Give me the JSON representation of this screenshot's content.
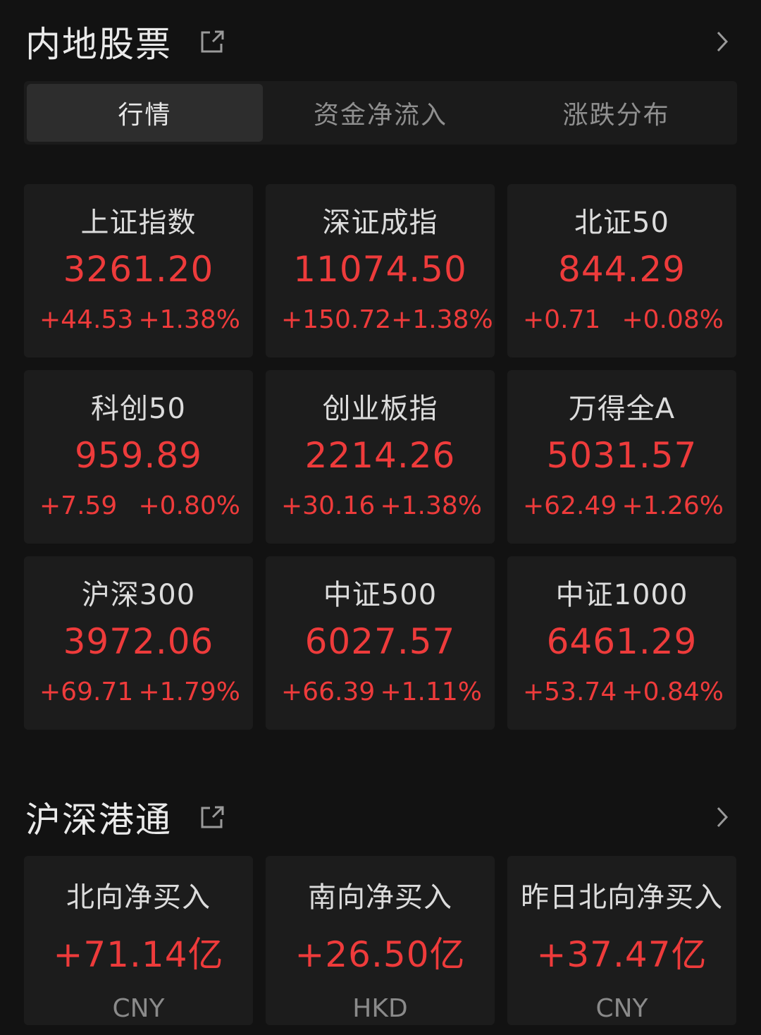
{
  "section1": {
    "title": "内地股票",
    "tabs": [
      "行情",
      "资金净流入",
      "涨跌分布"
    ],
    "cards": [
      {
        "name": "上证指数",
        "value": "3261.20",
        "change": "+44.53",
        "pct": "+1.38%"
      },
      {
        "name": "深证成指",
        "value": "11074.50",
        "change": "+150.72",
        "pct": "+1.38%"
      },
      {
        "name": "北证50",
        "value": "844.29",
        "change": "+0.71",
        "pct": "+0.08%"
      },
      {
        "name": "科创50",
        "value": "959.89",
        "change": "+7.59",
        "pct": "+0.80%"
      },
      {
        "name": "创业板指",
        "value": "2214.26",
        "change": "+30.16",
        "pct": "+1.38%"
      },
      {
        "name": "万得全A",
        "value": "5031.57",
        "change": "+62.49",
        "pct": "+1.26%"
      },
      {
        "name": "沪深300",
        "value": "3972.06",
        "change": "+69.71",
        "pct": "+1.79%"
      },
      {
        "name": "中证500",
        "value": "6027.57",
        "change": "+66.39",
        "pct": "+1.11%"
      },
      {
        "name": "中证1000",
        "value": "6461.29",
        "change": "+53.74",
        "pct": "+0.84%"
      }
    ]
  },
  "section2": {
    "title": "沪深港通",
    "cards": [
      {
        "name": "北向净买入",
        "value": "+71.14亿",
        "currency": "CNY"
      },
      {
        "name": "南向净买入",
        "value": "+26.50亿",
        "currency": "HKD"
      },
      {
        "name": "昨日北向净买入",
        "value": "+37.47亿",
        "currency": "CNY"
      }
    ]
  },
  "colors": {
    "background": "#121212",
    "card": "#1c1c1c",
    "up": "#ee3b3b",
    "muted": "#8a8a8a"
  },
  "icons": [
    "share-icon",
    "chevron-right-icon"
  ]
}
